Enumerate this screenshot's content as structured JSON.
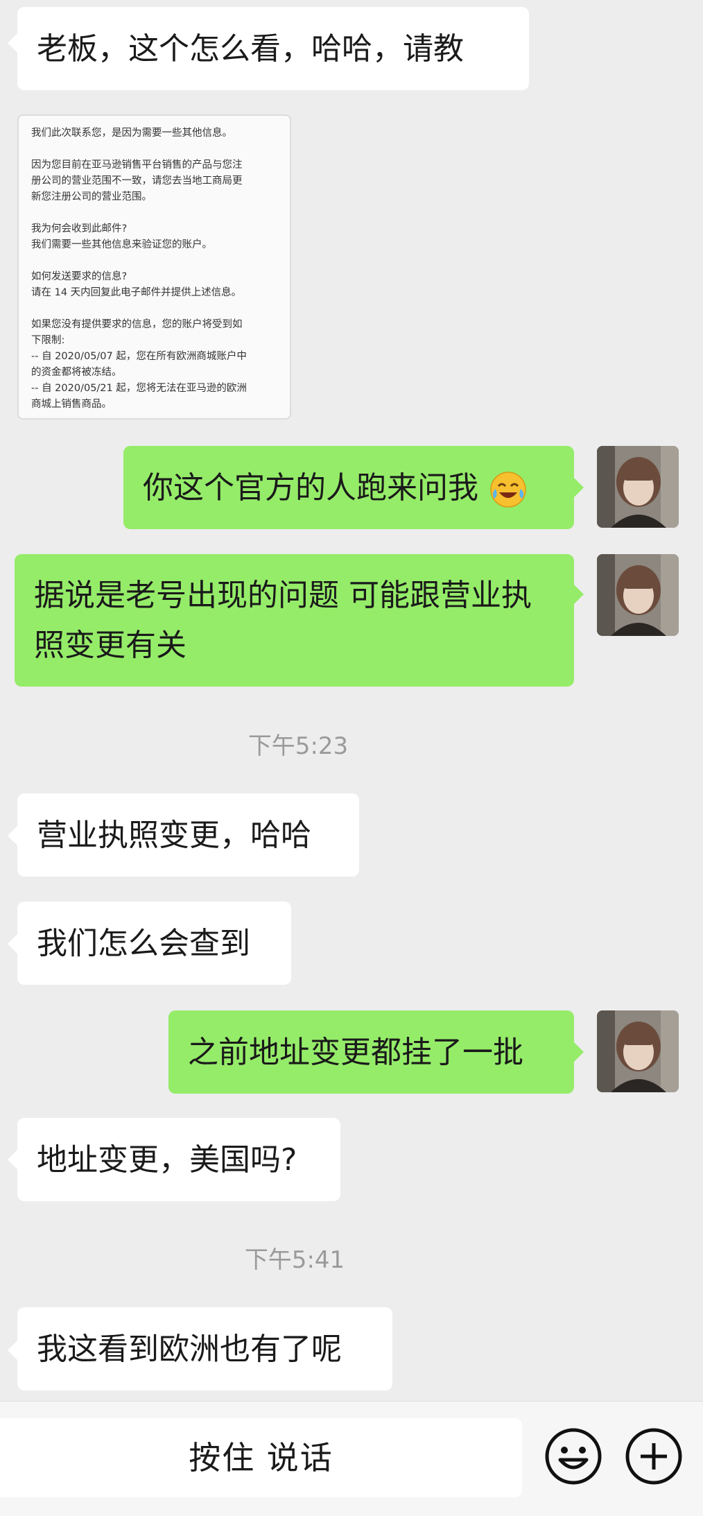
{
  "messages": {
    "m1": "老板，这个怎么看，哈哈，请教",
    "m3": "你这个官方的人跑来问我",
    "m4": "据说是老号出现的问题  可能跟营业执照变更有关",
    "t1": "下午5:23",
    "m5": "营业执照变更，哈哈",
    "m6": "我们怎么会查到",
    "m7": "之前地址变更都挂了一批",
    "m8": "地址变更，美国吗?",
    "t2": "下午5:41",
    "m9": "我这看到欧洲也有了呢"
  },
  "email": {
    "p1": "我们此次联系您，是因为需要一些其他信息。",
    "p2_l1": "因为您目前在亚马逊销售平台销售的产品与您注",
    "p2_l2": "册公司的营业范围不一致，请您去当地工商局更",
    "p2_l3": "新您注册公司的营业范围。",
    "p3_l1": "我为何会收到此邮件?",
    "p3_l2": "我们需要一些其他信息来验证您的账户。",
    "p4_l1": "如何发送要求的信息?",
    "p4_l2": "请在 14 天内回复此电子邮件并提供上述信息。",
    "p5_l1": "如果您没有提供要求的信息，您的账户将受到如",
    "p5_l2": "下限制:",
    "p5_l3": "-- 自 2020/05/07 起，您在所有欧洲商城账户中",
    "p5_l4": "的资金都将被冻结。",
    "p5_l5": "-- 自 2020/05/21 起，您将无法在亚马逊的欧洲",
    "p5_l6": "商城上销售商品。"
  },
  "input": {
    "voice_label": "按住 说话"
  },
  "icons": {
    "emoji": "face-with-tears-of-joy-icon",
    "sticker": "smiley-face-icon",
    "plus": "plus-circle-icon"
  },
  "colors": {
    "background": "#ededed",
    "incoming_bubble": "#ffffff",
    "outgoing_bubble": "#95ec69"
  }
}
